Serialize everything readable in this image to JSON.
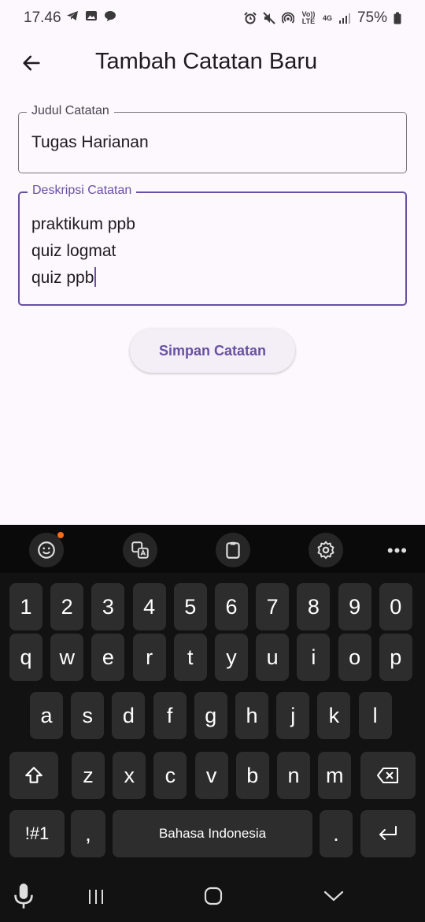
{
  "status": {
    "time": "17.46",
    "battery": "75%",
    "network": "4G",
    "volte": "Vo)) LTE"
  },
  "app_bar": {
    "title": "Tambah Catatan Baru",
    "back_icon": "arrow-left-icon"
  },
  "form": {
    "title_label": "Judul Catatan",
    "title_value": "Tugas Harianan",
    "desc_label": "Deskripsi Catatan",
    "desc_lines": [
      "praktikum ppb",
      "quiz logmat",
      "quiz ppb"
    ],
    "save_label": "Simpan Catatan"
  },
  "keyboard": {
    "toolbar_icons": [
      "emoji-icon",
      "translate-icon",
      "clipboard-icon",
      "settings-icon",
      "more-icon"
    ],
    "row_numbers": [
      "1",
      "2",
      "3",
      "4",
      "5",
      "6",
      "7",
      "8",
      "9",
      "0"
    ],
    "row1": [
      "q",
      "w",
      "e",
      "r",
      "t",
      "y",
      "u",
      "i",
      "o",
      "p"
    ],
    "row2": [
      "a",
      "s",
      "d",
      "f",
      "g",
      "h",
      "j",
      "k",
      "l"
    ],
    "row3": [
      "z",
      "x",
      "c",
      "v",
      "b",
      "n",
      "m"
    ],
    "symbols_label": "!#1",
    "comma": ",",
    "space_label": "Bahasa Indonesia",
    "period": "."
  },
  "colors": {
    "accent": "#6750a4",
    "background": "#fdf7fe",
    "keyboard_bg": "#121212",
    "key_bg": "#2d2d2d"
  }
}
